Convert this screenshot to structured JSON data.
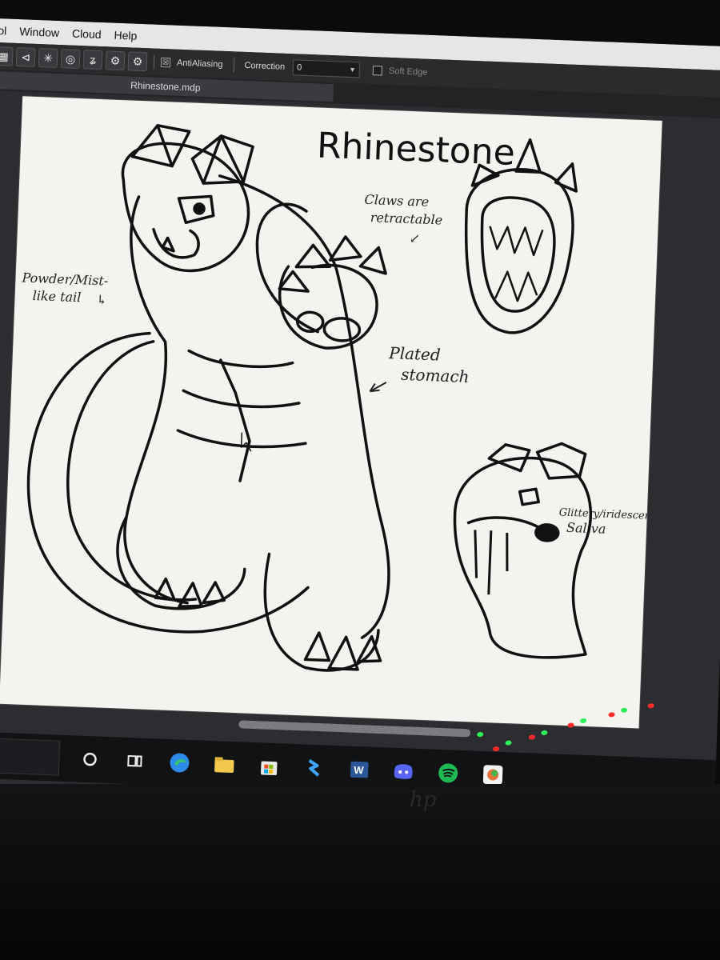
{
  "menubar": {
    "items": [
      "ol",
      "Window",
      "Cloud",
      "Help"
    ]
  },
  "toolbar": {
    "tools": [
      "grid-tool",
      "perspective-tool",
      "radial-tool",
      "concentric-tool",
      "curve-tool",
      "gear-tool",
      "settings-tool"
    ],
    "antialiasing_checkbox": "☒",
    "antialiasing_label": "AntiAliasing",
    "correction_label": "Correction",
    "correction_value": "0",
    "soft_edge_label": "Soft Edge"
  },
  "document": {
    "tab_title": "Rhinestone.mdp"
  },
  "canvas": {
    "title": "Rhinestone",
    "notes": {
      "tail": [
        "Powder/Mist-",
        "like tail",
        "↳"
      ],
      "claws": [
        "Claws are",
        "retractable",
        "↙"
      ],
      "stomach": [
        "Plated",
        "stomach"
      ],
      "saliva": [
        "Glittery/iridescent",
        "Saliva"
      ]
    }
  },
  "taskbar": {
    "icons": [
      "cortana-icon",
      "task-view-icon",
      "edge-icon",
      "file-explorer-icon",
      "store-icon",
      "vscode-icon",
      "word-icon",
      "discord-icon",
      "spotify-icon",
      "medibang-icon"
    ],
    "word_glyph": "W"
  },
  "colors": {
    "spotify": "#1db954",
    "discord": "#5865f2",
    "word": "#2b579a",
    "edge": "#2b8be6",
    "folder": "#f2c94c",
    "accent": "#6aa8ff"
  },
  "lights": [
    "#2ef05a",
    "#ff2a2a",
    "#2ef05a",
    "#ff2a2a",
    "#2ef05a",
    "#ff2a2a",
    "#2ef05a",
    "#ff2a2a",
    "#2ef05a",
    "#ff2a2a"
  ]
}
